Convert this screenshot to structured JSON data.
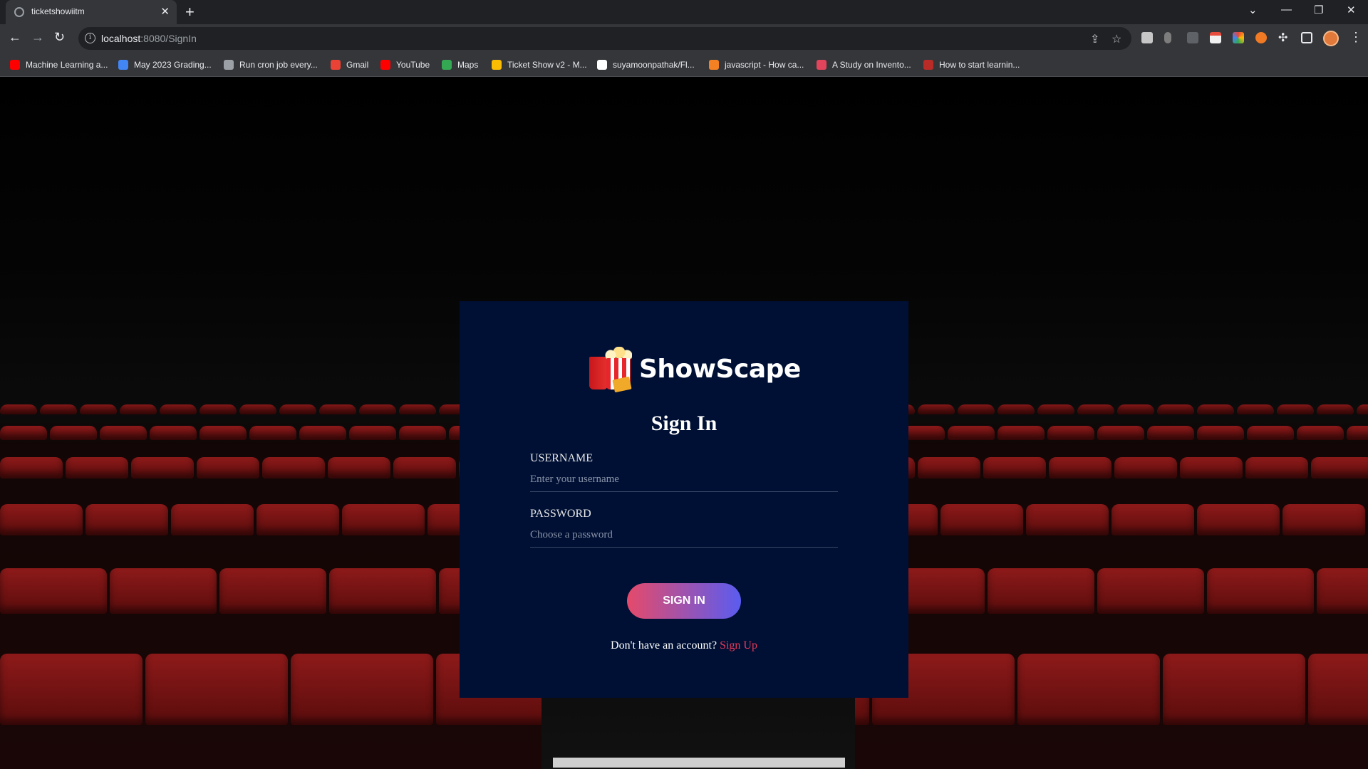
{
  "browser": {
    "tab_title": "ticketshowiitm",
    "tab_close": "✕",
    "new_tab": "+",
    "url_host": "localhost",
    "url_path": ":8080/SignIn",
    "bookmarks": [
      {
        "label": "Machine Learning a...",
        "color": "#ff0000"
      },
      {
        "label": "May 2023 Grading...",
        "color": "#4285f4"
      },
      {
        "label": "Run cron job every...",
        "color": "#9aa0a6"
      },
      {
        "label": "Gmail",
        "color": "#ea4335"
      },
      {
        "label": "YouTube",
        "color": "#ff0000"
      },
      {
        "label": "Maps",
        "color": "#34a853"
      },
      {
        "label": "Ticket Show v2 - M...",
        "color": "#fbbc04"
      },
      {
        "label": "suyamoonpathak/Fl...",
        "color": "#ffffff"
      },
      {
        "label": "javascript - How ca...",
        "color": "#f48024"
      },
      {
        "label": "A Study on Invento...",
        "color": "#e2445c"
      },
      {
        "label": "How to start learnin...",
        "color": "#b92b27"
      }
    ]
  },
  "card": {
    "brand": "ShowScape",
    "heading": "Sign In",
    "username_label": "USERNAME",
    "username_placeholder": "Enter your username",
    "password_label": "PASSWORD",
    "password_placeholder": "Choose a password",
    "submit_label": "SIGN IN",
    "signup_prompt": "Don't have an account?",
    "signup_link": "Sign Up"
  },
  "colors": {
    "card_bg": "#001034",
    "accent_pink": "#e83a5a",
    "button_gradient_start": "#e54a6a",
    "button_gradient_end": "#5a5cf0"
  }
}
